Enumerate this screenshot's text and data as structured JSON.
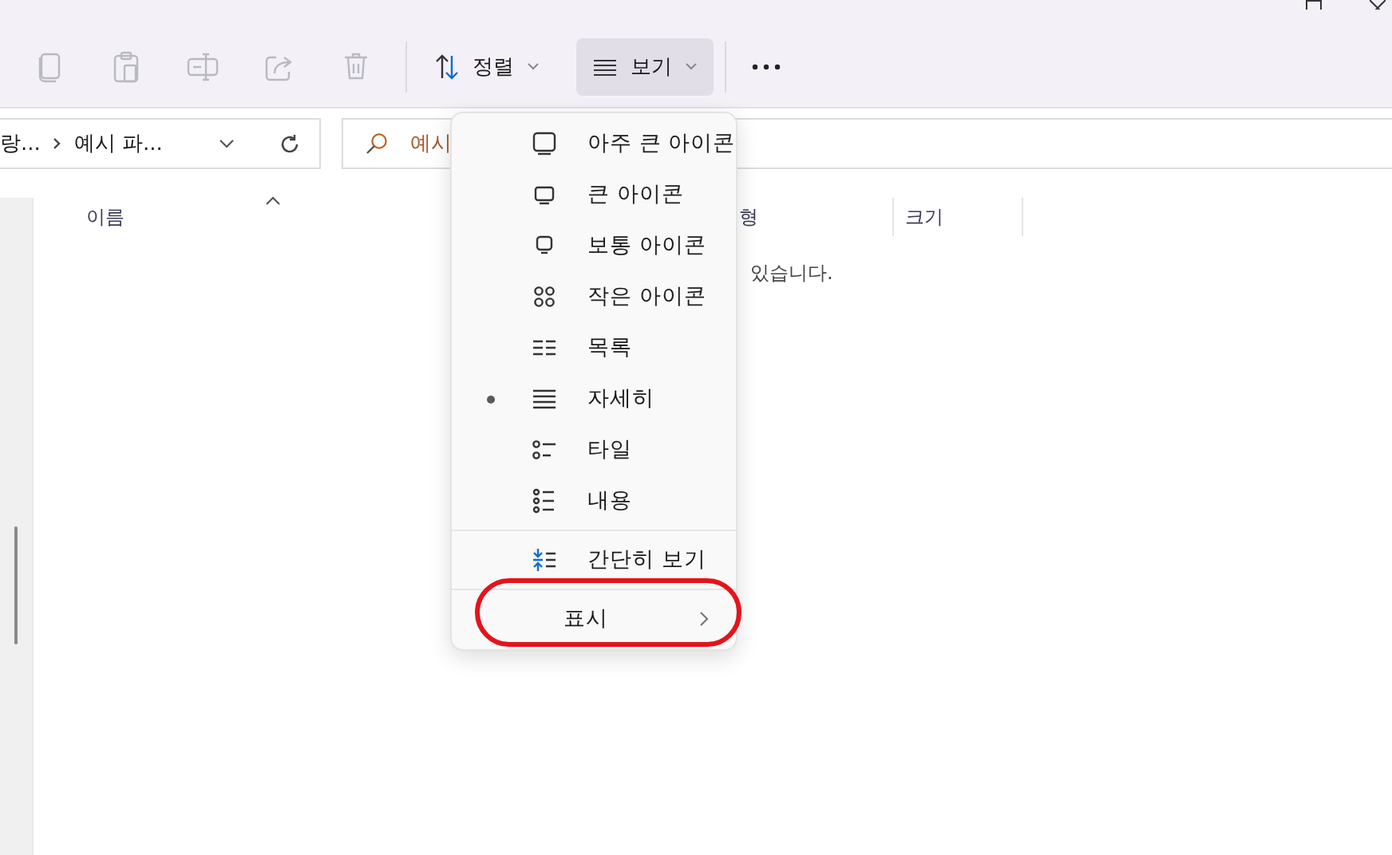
{
  "toolbar": {
    "actions": [
      {
        "kind": "copy",
        "disabled": true
      },
      {
        "kind": "paste",
        "disabled": true
      },
      {
        "kind": "rename",
        "disabled": true
      },
      {
        "kind": "share",
        "disabled": true
      },
      {
        "kind": "delete",
        "disabled": true
      }
    ],
    "sort_button": {
      "label": "정렬"
    },
    "view_button": {
      "label": "보기",
      "selected": true
    }
  },
  "address_bar": {
    "segments": [
      "랑...",
      "예시 파..."
    ]
  },
  "search": {
    "placeholder": "예시"
  },
  "columns": [
    {
      "label": "이름",
      "sorted": true
    },
    {
      "label": "형",
      "sorted": false
    },
    {
      "label": "크기",
      "sorted": false
    }
  ],
  "empty_message": "있습니다.",
  "view_menu": {
    "items": [
      {
        "kind": "extra-large",
        "label": "아주 큰 아이콘",
        "selected": false
      },
      {
        "kind": "large",
        "label": "큰 아이콘",
        "selected": false
      },
      {
        "kind": "medium",
        "label": "보통 아이콘",
        "selected": false
      },
      {
        "kind": "small",
        "label": "작은 아이콘",
        "selected": false
      },
      {
        "kind": "list",
        "label": "목록",
        "selected": false
      },
      {
        "kind": "details",
        "label": "자세히",
        "selected": true
      },
      {
        "kind": "tiles",
        "label": "타일",
        "selected": false
      },
      {
        "kind": "content",
        "label": "내용",
        "selected": false
      }
    ],
    "compact": {
      "label": "간단히 보기",
      "checked": false
    },
    "show": {
      "label": "표시"
    }
  }
}
